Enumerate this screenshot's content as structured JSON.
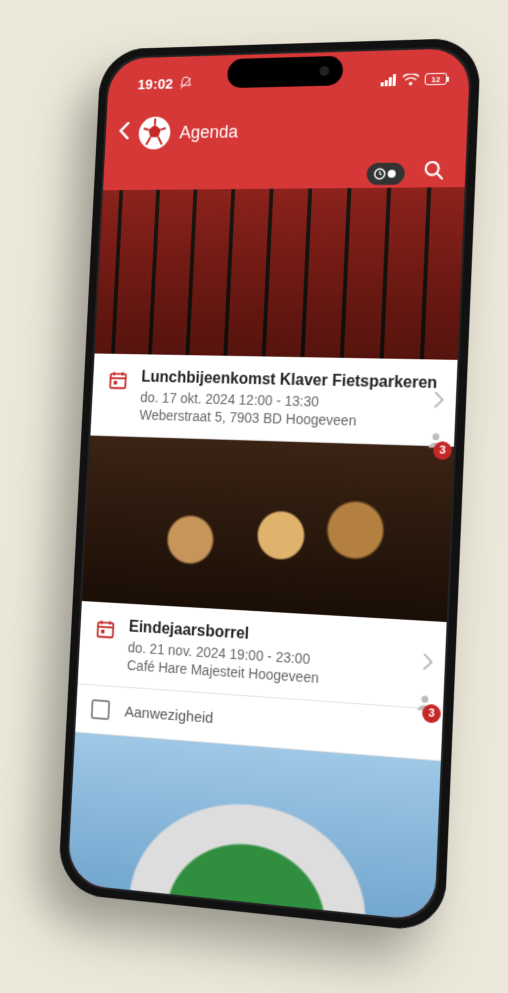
{
  "status": {
    "time": "19:02",
    "battery_text": "12"
  },
  "header": {
    "title": "Agenda"
  },
  "events": [
    {
      "title": "Lunchbijeenkomst Klaver Fietsparkeren",
      "datetime": "do. 17 okt. 2024 12:00 - 13:30",
      "location": "Weberstraat 5, 7903 BD Hoogeveen",
      "attendee_count": "3"
    },
    {
      "title": "Eindejaarsborrel",
      "datetime": "do. 21 nov. 2024 19:00 - 23:00",
      "location": "Café Hare Majesteit Hoogeveen",
      "attendee_count": "3"
    }
  ],
  "attendance": {
    "label": "Aanwezigheid"
  }
}
